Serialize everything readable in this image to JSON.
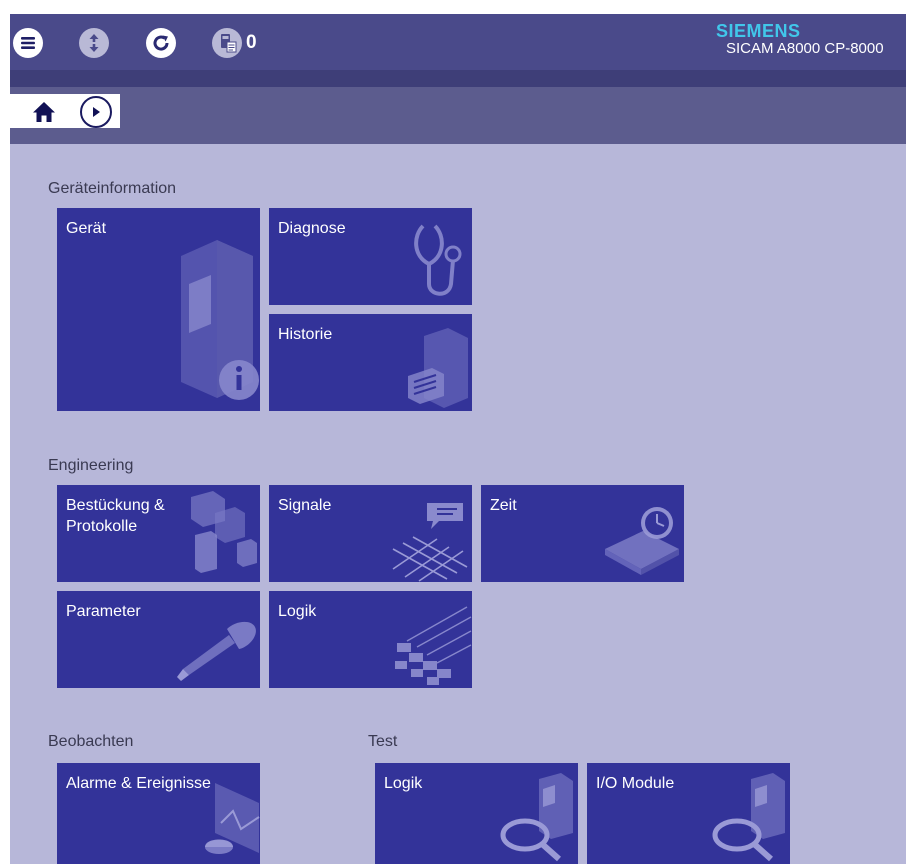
{
  "header": {
    "notification_count": "0",
    "brand": "SIEMENS",
    "model": "SICAM A8000 CP-8000",
    "icons": [
      "menu-icon",
      "upload-download-icon",
      "refresh-icon",
      "device-log-icon"
    ]
  },
  "nav": {
    "icons": [
      "home-icon",
      "forward-icon"
    ]
  },
  "sections": {
    "geraeteinformation": {
      "title": "Geräteinformation",
      "tiles": {
        "geraet": "Gerät",
        "diagnose": "Diagnose",
        "historie": "Historie"
      }
    },
    "engineering": {
      "title": "Engineering",
      "tiles": {
        "bestueckung": "Bestückung & Protokolle",
        "signale": "Signale",
        "zeit": "Zeit",
        "parameter": "Parameter",
        "logik": "Logik"
      }
    },
    "beobachten": {
      "title": "Beobachten",
      "tiles": {
        "alarme": "Alarme & Ereignisse"
      }
    },
    "test": {
      "title": "Test",
      "tiles": {
        "logik": "Logik",
        "io_module": "I/O Module"
      }
    }
  },
  "colors": {
    "tile": "#333399",
    "content_bg": "#b7b7d9",
    "topbar": "#4a4a8a",
    "navbar": "#5c5c8e",
    "brand": "#41c7ea"
  }
}
